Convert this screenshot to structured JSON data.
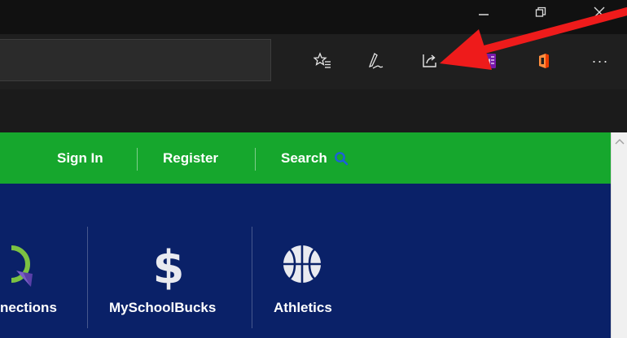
{
  "browser": {
    "window_controls": {
      "minimize": "–",
      "restore": "⧉",
      "close": "✕"
    },
    "toolbar": {
      "icons": [
        "favorites-list-icon",
        "pen-icon",
        "share-icon",
        "onenote-icon",
        "office-icon",
        "more-icon"
      ],
      "more_label": "···",
      "onenote_text": "N"
    }
  },
  "site": {
    "topbar": {
      "sign_in": "Sign In",
      "register": "Register",
      "search": "Search"
    },
    "quicklinks": [
      {
        "label": "nections",
        "icon": "connections-icon"
      },
      {
        "label": "MySchoolBucks",
        "icon": "dollar-icon"
      },
      {
        "label": "Athletics",
        "icon": "basketball-icon"
      }
    ],
    "colors": {
      "green": "#16a72d",
      "navy": "#0a2168",
      "annotation_arrow": "#ee1b1b"
    }
  }
}
